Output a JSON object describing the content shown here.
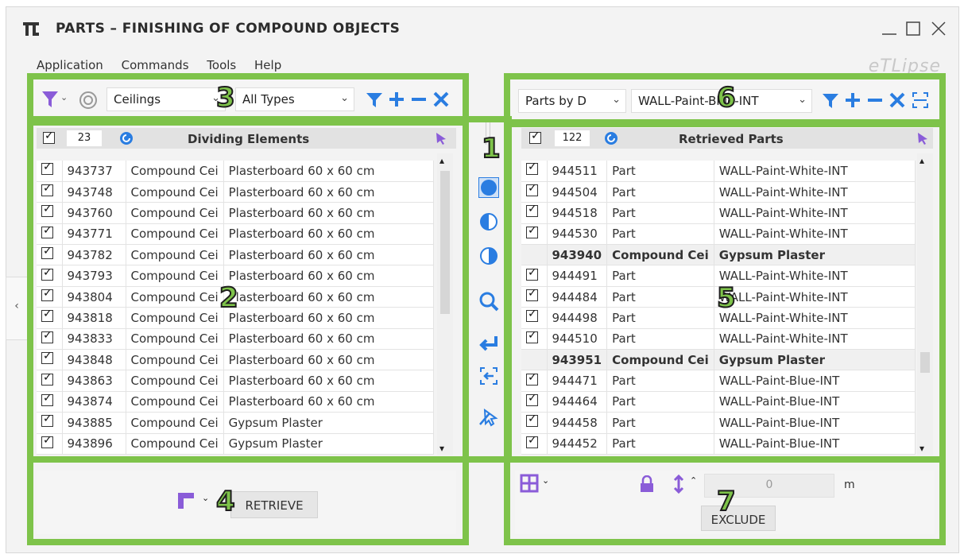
{
  "window": {
    "title": "PARTS – FINISHING OF COMPOUND OBJECTS",
    "brand": "eTLipse"
  },
  "menu": [
    "Application",
    "Commands",
    "Tools",
    "Help"
  ],
  "left": {
    "category": "Ceilings",
    "type": "All Types",
    "count": "23",
    "caption": "Dividing Elements",
    "rows": [
      [
        "943737",
        "Compound Cei",
        "Plasterboard 60 x 60 cm"
      ],
      [
        "943748",
        "Compound Cei",
        "Plasterboard 60 x 60 cm"
      ],
      [
        "943760",
        "Compound Cei",
        "Plasterboard 60 x 60 cm"
      ],
      [
        "943771",
        "Compound Cei",
        "Plasterboard 60 x 60 cm"
      ],
      [
        "943782",
        "Compound Cei",
        "Plasterboard 60 x 60 cm"
      ],
      [
        "943793",
        "Compound Cei",
        "Plasterboard 60 x 60 cm"
      ],
      [
        "943804",
        "Compound Cei",
        "Plasterboard 60 x 60 cm"
      ],
      [
        "943818",
        "Compound Cei",
        "Plasterboard 60 x 60 cm"
      ],
      [
        "943833",
        "Compound Cei",
        "Plasterboard 60 x 60 cm"
      ],
      [
        "943848",
        "Compound Cei",
        "Plasterboard 60 x 60 cm"
      ],
      [
        "943863",
        "Compound Cei",
        "Plasterboard 60 x 60 cm"
      ],
      [
        "943874",
        "Compound Cei",
        "Plasterboard 60 x 60 cm"
      ],
      [
        "943885",
        "Compound Cei",
        "Gypsum Plaster"
      ],
      [
        "943896",
        "Compound Cei",
        "Gypsum Plaster"
      ]
    ],
    "retrieve_label": "RETRIEVE"
  },
  "right": {
    "mode": "Parts by D",
    "material": "WALL-Paint-Blue-INT",
    "count": "122",
    "caption": "Retrieved Parts",
    "rows": [
      {
        "check": true,
        "id": "944511",
        "kind": "Part",
        "name": "WALL-Paint-White-INT"
      },
      {
        "check": true,
        "id": "944504",
        "kind": "Part",
        "name": "WALL-Paint-White-INT"
      },
      {
        "check": true,
        "id": "944518",
        "kind": "Part",
        "name": "WALL-Paint-White-INT"
      },
      {
        "check": true,
        "id": "944530",
        "kind": "Part",
        "name": "WALL-Paint-White-INT"
      },
      {
        "check": false,
        "id": "943940",
        "kind": "Compound Cei",
        "name": "Gypsum Plaster",
        "group": true
      },
      {
        "check": true,
        "id": "944491",
        "kind": "Part",
        "name": "WALL-Paint-White-INT"
      },
      {
        "check": true,
        "id": "944484",
        "kind": "Part",
        "name": "WALL-Paint-White-INT"
      },
      {
        "check": true,
        "id": "944498",
        "kind": "Part",
        "name": "WALL-Paint-White-INT"
      },
      {
        "check": true,
        "id": "944510",
        "kind": "Part",
        "name": "WALL-Paint-White-INT"
      },
      {
        "check": false,
        "id": "943951",
        "kind": "Compound Cei",
        "name": "Gypsum Plaster",
        "group": true
      },
      {
        "check": true,
        "id": "944471",
        "kind": "Part",
        "name": "WALL-Paint-Blue-INT"
      },
      {
        "check": true,
        "id": "944464",
        "kind": "Part",
        "name": "WALL-Paint-Blue-INT"
      },
      {
        "check": true,
        "id": "944458",
        "kind": "Part",
        "name": "WALL-Paint-Blue-INT"
      },
      {
        "check": true,
        "id": "944452",
        "kind": "Part",
        "name": "WALL-Paint-Blue-INT"
      }
    ],
    "offset_value": "0",
    "offset_unit": "m",
    "exclude_label": "EXCLUDE"
  },
  "markers": [
    "1",
    "2",
    "3",
    "4",
    "5",
    "6",
    "7"
  ],
  "colors": {
    "accent_blue": "#2a7de1",
    "marker_green": "#7ec34a",
    "purple": "#8a5cd8"
  }
}
